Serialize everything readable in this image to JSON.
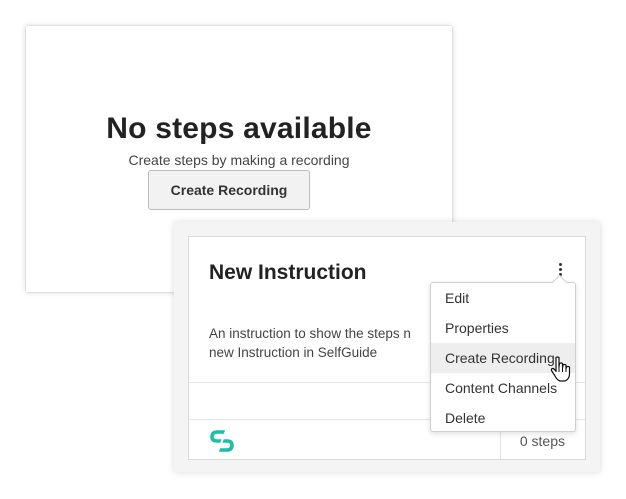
{
  "empty_state": {
    "title": "No steps available",
    "subtitle": "Create steps by making a recording",
    "button_label": "Create Recording"
  },
  "instruction_card": {
    "title": "New Instruction",
    "description_line1": "An instruction to show the steps n",
    "description_line2": "new Instruction in SelfGuide",
    "steps_count": "0 steps",
    "logo_icon": "selfguide-logo-icon",
    "more_icon": "kebab-menu-icon"
  },
  "context_menu": {
    "items": [
      {
        "label": "Edit"
      },
      {
        "label": "Properties"
      },
      {
        "label": "Create Recording"
      },
      {
        "label": "Content Channels"
      },
      {
        "label": "Delete"
      }
    ],
    "active_index": 2
  },
  "colors": {
    "logo_accent": "#1bbfa8",
    "menu_hover": "#eeeeee",
    "button_bg": "#f2f2f2"
  }
}
